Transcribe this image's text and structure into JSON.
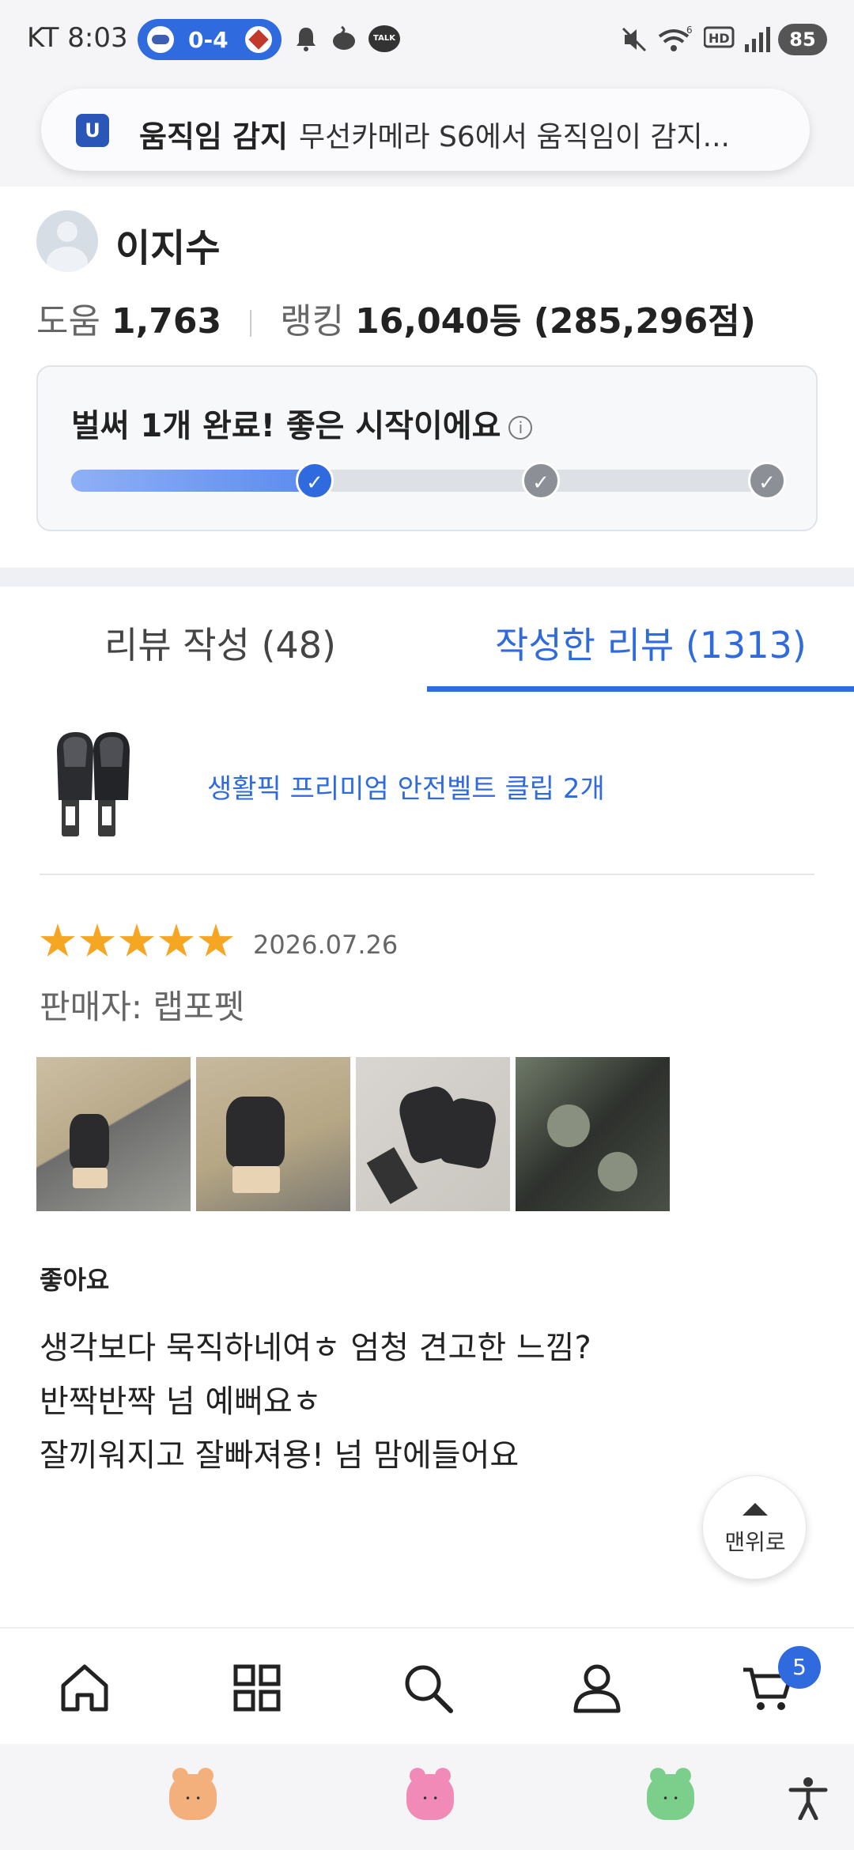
{
  "status_bar": {
    "carrier_time": "KT 8:03",
    "score": "0-4",
    "talk_label": "TALK",
    "battery": "85"
  },
  "notification": {
    "app_icon_letter": "U",
    "title": "움직임 감지",
    "body": "무선카메라 S6에서 움직임이 감지..."
  },
  "profile": {
    "name": "이지수",
    "help_label": "도움",
    "help_value": "1,763",
    "rank_label": "랭킹",
    "rank_value": "16,040등 (285,296점)"
  },
  "progress": {
    "title": "벌써 1개 완료! 좋은 시작이에요",
    "info_icon": "i",
    "fraction": 0.34,
    "check": "✓"
  },
  "tabs": [
    {
      "label": "리뷰 작성 (48)"
    },
    {
      "label": "작성한 리뷰 (1313)"
    }
  ],
  "product": {
    "name": "생활픽 프리미엄 안전벨트 클립 2개"
  },
  "review": {
    "rating": 5,
    "date": "2026.07.26",
    "seller": "판매자: 랩포펫",
    "title": "좋아요",
    "lines": [
      "생각보다 묵직하네여ㅎ 엄청 견고한 느낌?",
      "반짝반짝 넘 예뻐요ㅎ",
      "잘끼워지고 잘빠져용! 넘 맘에들어요"
    ]
  },
  "top_button": {
    "label": "맨위로"
  },
  "bottom_nav": {
    "items": [
      "home-icon",
      "category-icon",
      "search-icon",
      "profile-icon",
      "cart-icon"
    ],
    "cart_count": "5"
  },
  "colors": {
    "accent": "#2f6bde",
    "star": "#f5a623"
  }
}
